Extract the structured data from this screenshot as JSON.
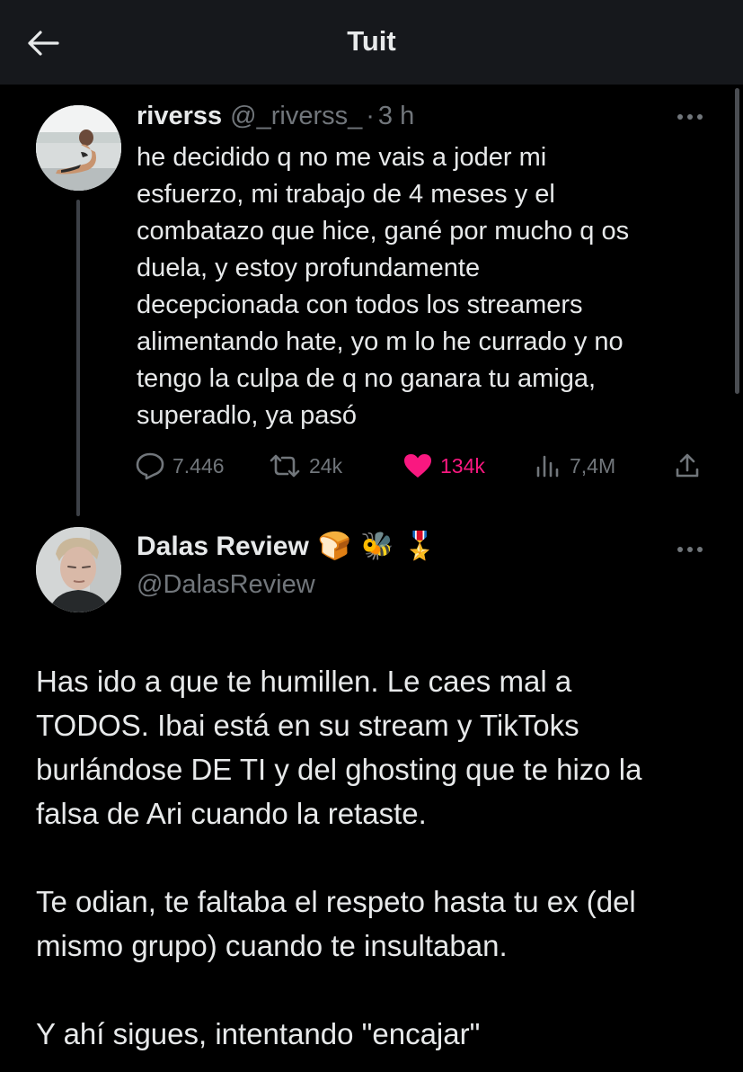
{
  "header": {
    "title": "Tuit",
    "back_icon": "arrow-left-icon"
  },
  "tweet": {
    "author_name": "riverss",
    "handle": "@_riverss_",
    "separator": "·",
    "time": "3 h",
    "text": "he decidido q no me vais a joder mi\nesfuerzo, mi trabajo de 4 meses y el\ncombatazo que hice, gané por mucho q os\nduela, y estoy profundamente\ndecepcionada con todos los streamers\nalimentando hate, yo m lo he currado y no\ntengo la culpa de q no ganara tu amiga,\nsuperadlo, ya pasó",
    "stats": {
      "replies": "7.446",
      "retweets": "24k",
      "likes": "134k",
      "views": "7,4M"
    },
    "liked": true
  },
  "reply": {
    "author_name": "Dalas Review",
    "emojis": [
      "🍞",
      "🐝",
      "🎖️"
    ],
    "handle": "@DalasReview",
    "text": "Has ido a que te humillen. Le caes mal a\nTODOS. Ibai está en su stream y TikToks\nburlándose DE TI y del ghosting que te hizo la\nfalsa de Ari cuando la retaste.\n\nTe odian, te faltaba el respeto hasta tu ex (del\nmismo grupo) cuando te insultaban.\n\nY ahí sigues, intentando \"encajar\""
  },
  "colors": {
    "background": "#000000",
    "topbar": "#16181c",
    "text": "#e7e9ea",
    "muted": "#71767b",
    "like": "#f91880"
  }
}
